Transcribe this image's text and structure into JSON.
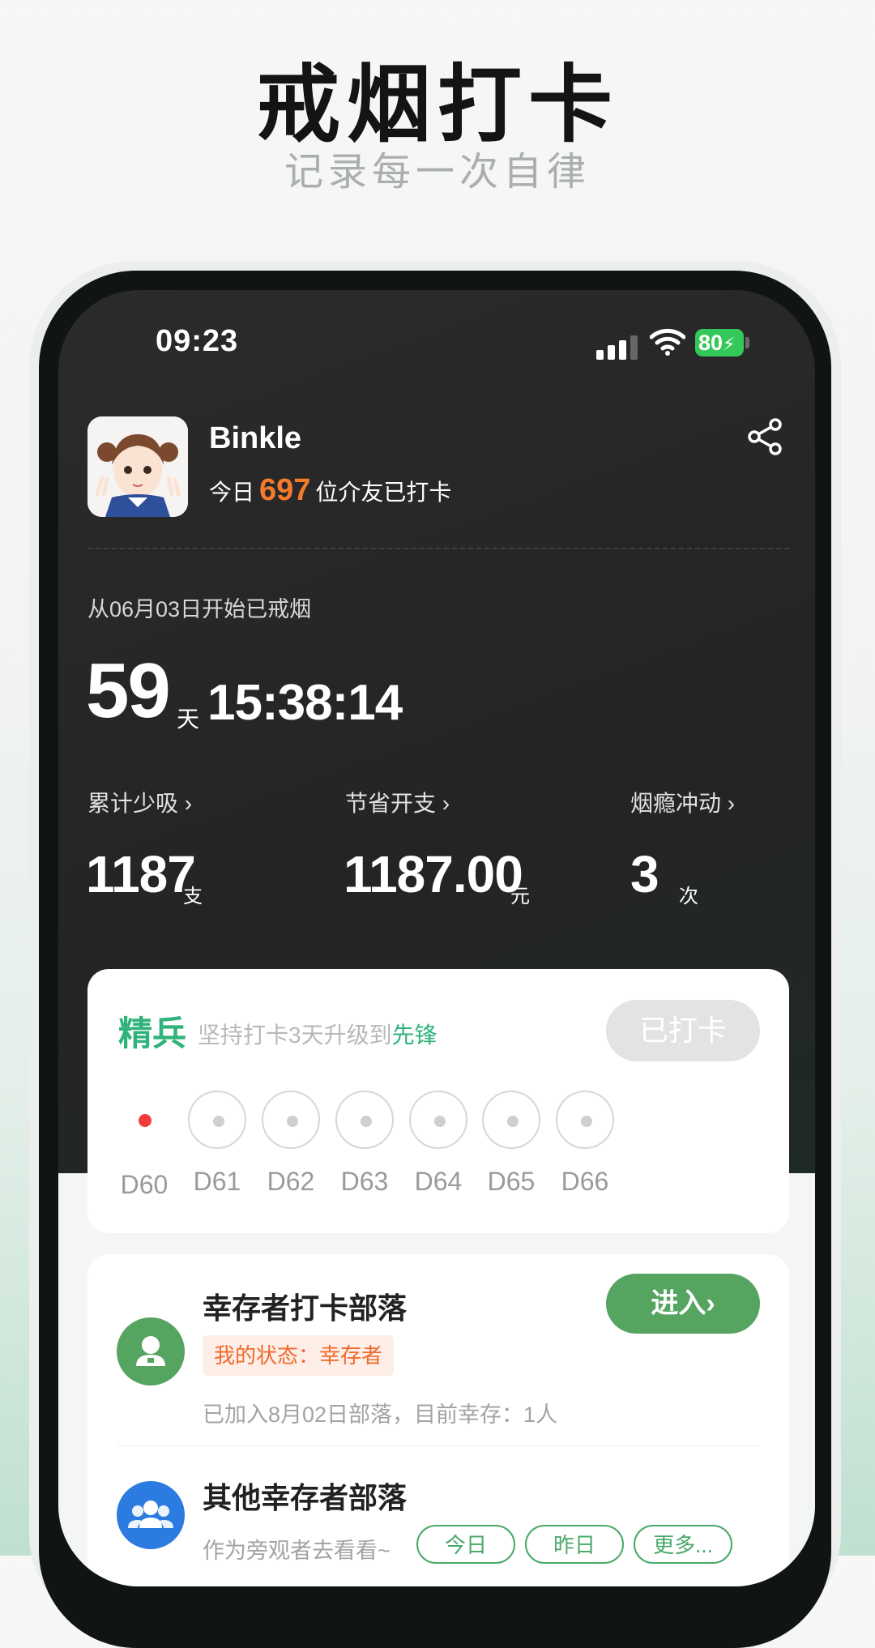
{
  "promo": {
    "title": "戒烟打卡",
    "subtitle": "记录每一次自律"
  },
  "status_bar": {
    "time": "09:23",
    "battery": "80"
  },
  "profile": {
    "username": "Binkle",
    "today_prefix": "今日",
    "today_count": "697",
    "today_suffix": "位介友已打卡"
  },
  "quit": {
    "since_label": "从06月03日开始已戒烟",
    "days": "59",
    "days_unit": "天",
    "time": "15:38:14"
  },
  "stats": [
    {
      "label": "累计少吸",
      "value": "1187",
      "unit": "支"
    },
    {
      "label": "节省开支",
      "value": "1187.00",
      "unit": "元"
    },
    {
      "label": "烟瘾冲动",
      "value": "3",
      "unit": "次"
    }
  ],
  "rank": {
    "title": "精兵",
    "desc_prefix": "坚持打卡3天升级到",
    "next_rank": "先锋",
    "checked_label": "已打卡",
    "days": [
      "D60",
      "D61",
      "D62",
      "D63",
      "D64",
      "D65",
      "D66"
    ]
  },
  "tribe": {
    "title": "幸存者打卡部落",
    "status": "我的状态：幸存者",
    "info": "已加入8月02日部落，目前幸存：1人",
    "enter_label": "进入›",
    "other_title": "其他幸存者部落",
    "other_sub": "作为旁观者去看看~",
    "pills": [
      "今日",
      "昨日",
      "更多..."
    ]
  },
  "colors": {
    "accent_green": "#2fb37a",
    "button_green": "#55a460",
    "highlight_orange": "#f47a2c",
    "status_orange": "#f06a2c",
    "current_day_red": "#f03c3c",
    "battery_green": "#34c759",
    "tribe_icon_blue": "#2b7be0"
  }
}
